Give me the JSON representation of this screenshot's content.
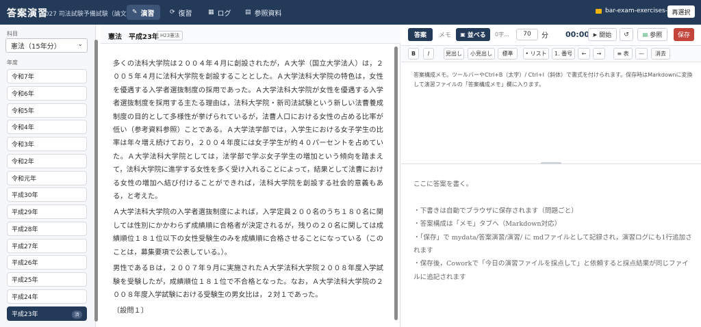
{
  "header": {
    "title": "答案演習",
    "subtitle": "2027 司法試験予備試験（論文）",
    "tabs": [
      {
        "label": "演習",
        "icon": "pencil-icon",
        "active": true
      },
      {
        "label": "復習",
        "icon": "refresh-icon",
        "active": false
      },
      {
        "label": "ログ",
        "icon": "chart-icon",
        "active": false
      },
      {
        "label": "参照資料",
        "icon": "book-icon",
        "active": false
      }
    ],
    "project_name": "bar-exam-exercises-app",
    "reselect_label": "再選択"
  },
  "sidebar": {
    "subject_label": "科目",
    "subject_value": "憲法（15年分）",
    "year_label": "年度",
    "years": [
      {
        "label": "令和7年"
      },
      {
        "label": "令和6年"
      },
      {
        "label": "令和5年"
      },
      {
        "label": "令和4年"
      },
      {
        "label": "令和3年"
      },
      {
        "label": "令和2年"
      },
      {
        "label": "令和元年"
      },
      {
        "label": "平成30年"
      },
      {
        "label": "平成29年"
      },
      {
        "label": "平成28年"
      },
      {
        "label": "平成27年"
      },
      {
        "label": "平成26年"
      },
      {
        "label": "平成25年"
      },
      {
        "label": "平成24年"
      },
      {
        "label": "平成23年",
        "active": true,
        "badge": "済"
      }
    ]
  },
  "problem": {
    "title": "憲法　平成23年",
    "tag": "H23憲法",
    "paragraphs": [
      "多くの法科大学院は２００４年４月に創設されたが，Ａ大学（国立大学法人）は，２００５年４月に法科大学院を創設することとした。Ａ大学法科大学院の特色は，女性を優遇する入学者選抜制度の採用であった。Ａ大学法科大学院が女性を優遇する入学者選抜制度を採用する主たる理由は，法科大学院・新司法試験という新しい法曹養成制度の目的として多様性が挙げられているが，法曹人口における女性の占める比率が低い（参考資料参照）ことである。Ａ大学法学部では，入学生における女子学生の比率は年々増え続けており，２００４年度には女子学生が約４０パーセントを占めていた。Ａ大学法科大学院としては，法学部で学ぶ女子学生の増加という傾向を踏まえて，法科大学院に進学する女性を多く受け入れることによって，結果として法曹における女性の増加へ結び付けることができれば，法科大学院を創設する社会的意義もある，と考えた。",
      "Ａ大学法科大学院の入学者選抜制度によれば，入学定員２００名のうち１８０名に関しては性別にかかわらず成績順に合格者が決定されるが，残りの２０名に関しては成績順位１８１位以下の女性受験生のみを成績順に合格させることになっている（このことは，募集要項で公表している。）。",
      "男性であるＢは，２００７年９月に実施されたＡ大学法科大学院２００８年度入学試験を受験したが，成績順位１８１位で不合格となった。なお，Ａ大学法科大学院の２００８年度入学試験における受験生の男女比は，２対１であった。",
      "〔設問１〕"
    ]
  },
  "editor": {
    "tab_answer": "答案",
    "tab_memo": "メモ",
    "layout_label": "並べる",
    "char_count": "0字...",
    "minutes_value": "70",
    "minutes_unit": "分",
    "timer": "00:00",
    "start_label": "開始",
    "reset_label": "↺",
    "reference_label": "参照",
    "save_label": "保存",
    "format_buttons": [
      "B",
      "I",
      "見出し",
      "小見出し",
      "標準",
      "• リスト",
      "1. 番号",
      "←",
      "→",
      "≡ 表",
      "—",
      "消去"
    ],
    "memo_placeholder": "答案構成メモ。ツールバーやCtrl+B（太字）/ Ctrl+I（斜体）で書式を付けられます。保存時はMarkdownに変換して演習ファイルの「答案構成メモ」欄に入ります。",
    "answer_placeholder_lines": [
      "ここに答案を書く。",
      "",
      "・下書きは自動でブラウザに保存されます（問題ごと）",
      "・答案構成は「メモ」タブへ（Markdown対応）",
      "・「保存」で mydata/答案演習/演習/ に mdファイルとして記録され，演習ログにも1行追加されます",
      "・保存後，Coworkで「今日の演習ファイルを採点して」と依頼すると採点結果が同じファイルに追記されます"
    ]
  }
}
